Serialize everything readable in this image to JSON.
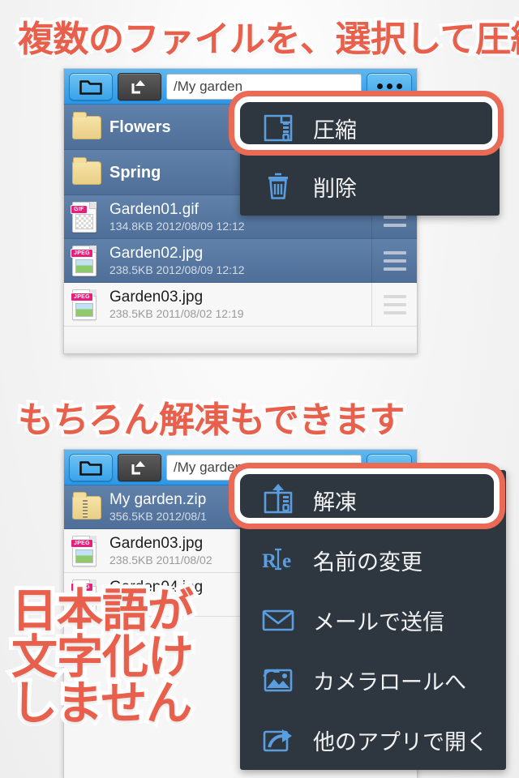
{
  "headlines": {
    "first": "複数のファイルを、選択して圧縮",
    "second": "もちろん解凍もできます"
  },
  "overlay_text": {
    "line1": "日本語が",
    "line2": "文字化け",
    "line3": "しません"
  },
  "colors": {
    "accent_red": "#e8604c",
    "toolbar_blue": "#2b97e8",
    "row_selected": "#5f81aa",
    "menu_background": "#2e3740",
    "menu_icon_blue": "#5a9ee0",
    "highlight_ring": "#ea6a55"
  },
  "screenshot_one": {
    "toolbar": {
      "folder_button": "folder-icon",
      "up_button": "up-arrow-icon",
      "path_value": "/My garden",
      "path_placeholder": "/",
      "more_button": "•••"
    },
    "rows": [
      {
        "name": "Flowers",
        "meta": "",
        "icon": "folder",
        "selected": true,
        "handle": false
      },
      {
        "name": "Spring",
        "meta": "",
        "icon": "folder",
        "selected": true,
        "handle": false
      },
      {
        "name": "Garden01.gif",
        "meta": "134.8KB  2012/08/09 12:12",
        "icon": "gif",
        "selected": true,
        "handle": true,
        "badge": "GIF"
      },
      {
        "name": "Garden02.jpg",
        "meta": "238.5KB  2012/08/09 12:12",
        "icon": "jpeg",
        "selected": true,
        "handle": true,
        "badge": "JPEG"
      },
      {
        "name": "Garden03.jpg",
        "meta": "238.5KB  2011/08/02 12:19",
        "icon": "jpeg",
        "selected": false,
        "handle": true,
        "badge": "JPEG"
      }
    ],
    "context_menu": [
      {
        "label": "圧縮",
        "icon": "compress-icon",
        "highlighted": true
      },
      {
        "label": "削除",
        "icon": "trash-icon",
        "highlighted": false
      }
    ]
  },
  "screenshot_two": {
    "toolbar": {
      "folder_button": "folder-icon",
      "up_button": "up-arrow-icon",
      "path_value": "/My garden",
      "path_placeholder": "/",
      "more_button": "•••"
    },
    "rows": [
      {
        "name": "My garden.zip",
        "meta": "356.5KB  2012/08/1",
        "icon": "zip",
        "selected": true,
        "handle": false
      },
      {
        "name": "Garden03.jpg",
        "meta": "238.5KB  2011/08/02",
        "icon": "jpeg",
        "selected": false,
        "handle": false,
        "badge": "JPEG"
      },
      {
        "name": "Garden04.jpg",
        "meta": "/09",
        "icon": "jpeg",
        "selected": false,
        "handle": false,
        "badge": "JPEG"
      }
    ],
    "context_menu": [
      {
        "label": "解凍",
        "icon": "extract-icon",
        "highlighted": true
      },
      {
        "label": "名前の変更",
        "icon": "rename-icon",
        "highlighted": false
      },
      {
        "label": "メールで送信",
        "icon": "mail-icon",
        "highlighted": false
      },
      {
        "label": "カメラロールへ",
        "icon": "camera-roll-icon",
        "highlighted": false
      },
      {
        "label": "他のアプリで開く",
        "icon": "open-in-icon",
        "highlighted": false
      }
    ]
  }
}
